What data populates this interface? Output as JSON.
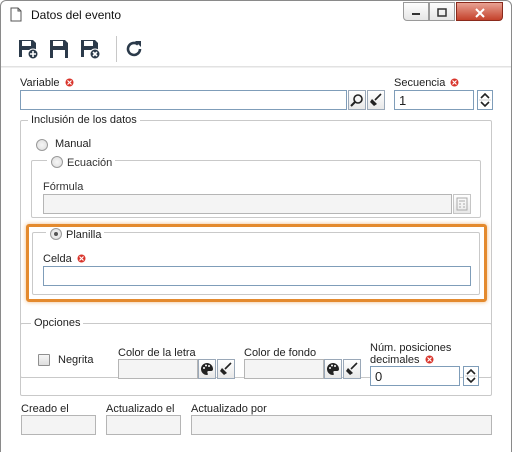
{
  "window": {
    "title": "Datos del evento"
  },
  "toolbar": {
    "buttons": [
      {
        "name": "save-new-icon"
      },
      {
        "name": "save-icon"
      },
      {
        "name": "save-close-icon"
      },
      {
        "name": "refresh-icon"
      }
    ]
  },
  "form": {
    "variable_label": "Variable",
    "variable_value": "",
    "secuencia_label": "Secuencia",
    "secuencia_value": "1",
    "inclusion_title": "Inclusión de los datos",
    "manual_label": "Manual",
    "ecuacion_label": "Ecuación",
    "formula_label": "Fórmula",
    "formula_value": "",
    "planilla_label": "Planilla",
    "celda_label": "Celda",
    "celda_value": "",
    "opciones_title": "Opciones",
    "negrita_label": "Negrita",
    "color_letra_label": "Color de la letra",
    "color_fondo_label": "Color de fondo",
    "num_pos_label_1": "Núm. posiciones",
    "num_pos_label_2": "decimales",
    "num_pos_value": "0",
    "creado_label": "Creado el",
    "actualizado_label": "Actualizado el",
    "actualizado_por_label": "Actualizado por"
  },
  "colors": {
    "required": "#d9342b",
    "highlight": "#e48a2e",
    "input_border": "#7f9db9"
  }
}
